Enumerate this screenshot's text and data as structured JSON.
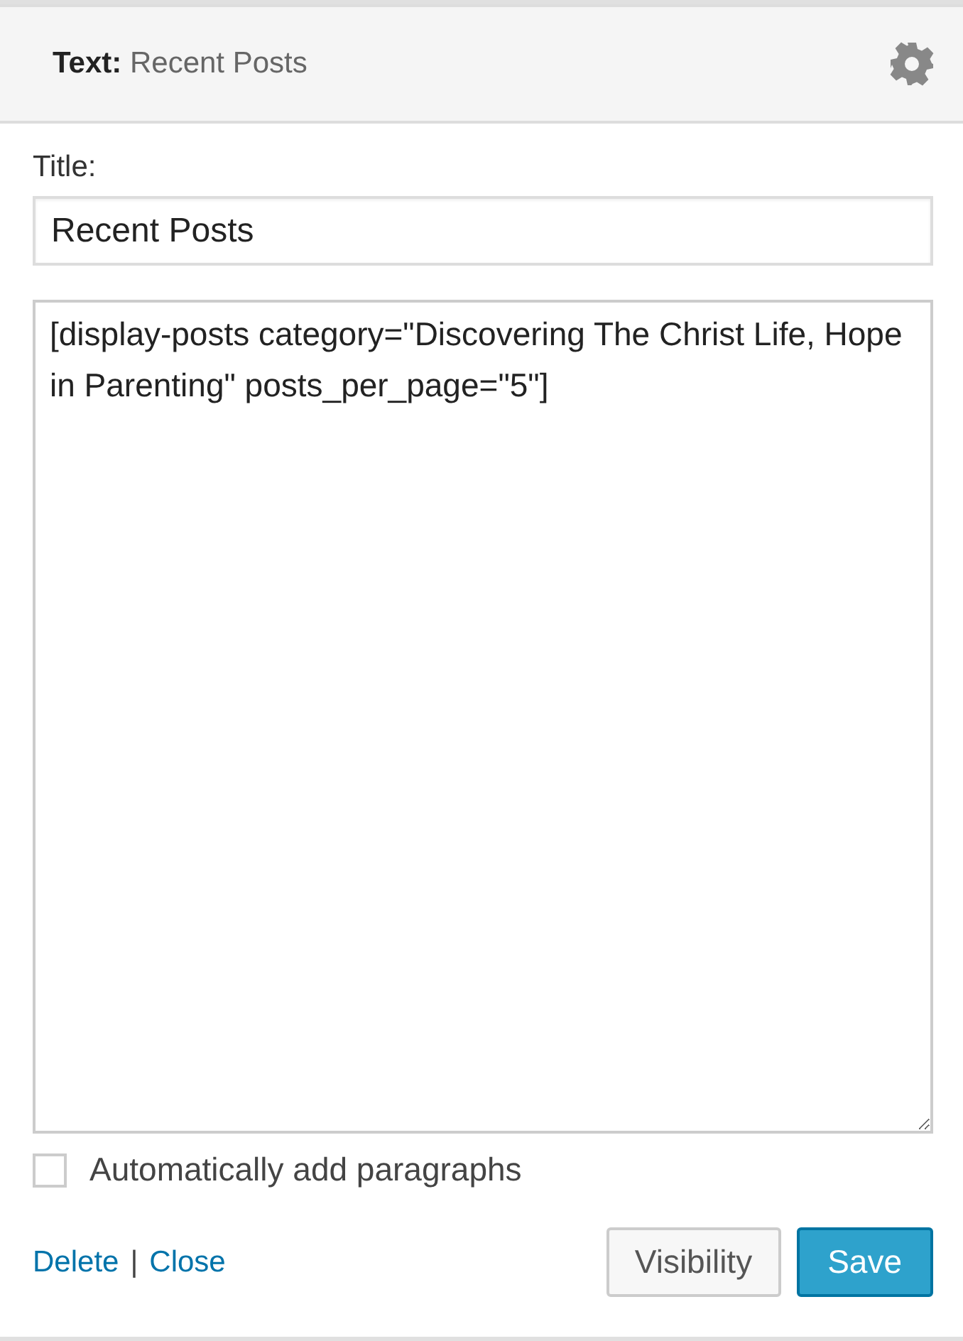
{
  "header": {
    "widget_type": "Text:",
    "widget_title": "Recent Posts"
  },
  "title_field": {
    "label": "Title:",
    "value": "Recent Posts"
  },
  "content": {
    "value": "[display-posts category=\"Discovering The Christ Life, Hope in Parenting\" posts_per_page=\"5\"]"
  },
  "auto_paragraphs": {
    "label": "Automatically add paragraphs",
    "checked": false
  },
  "links": [
    {
      "label": "Delete"
    },
    {
      "label": "Close"
    }
  ],
  "link_separator": "|",
  "buttons": [
    {
      "label": "Visibility",
      "kind": "secondary"
    },
    {
      "label": "Save",
      "kind": "primary"
    }
  ]
}
